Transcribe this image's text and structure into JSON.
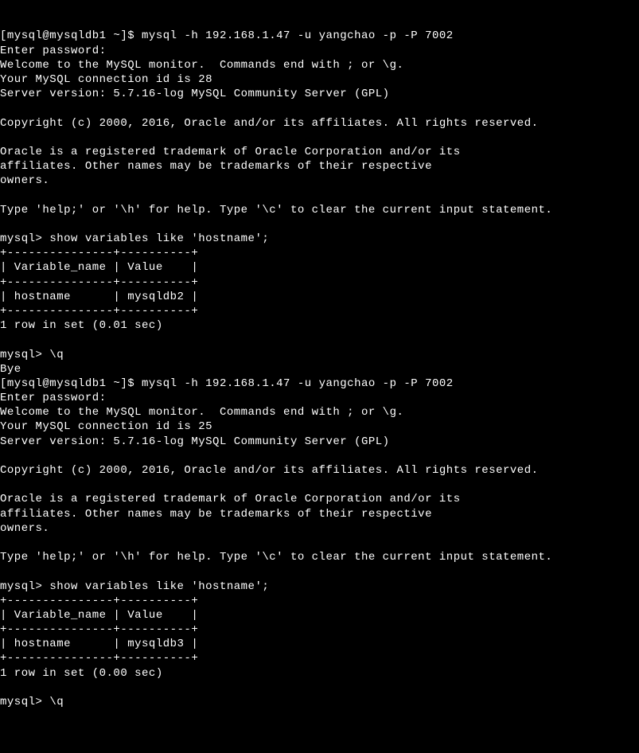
{
  "session1": {
    "shell_prompt": "[mysql@mysqldb1 ~]$ ",
    "connect_cmd": "mysql -h 192.168.1.47 -u yangchao -p -P 7002",
    "enter_password": "Enter password:",
    "welcome": "Welcome to the MySQL monitor.  Commands end with ; or \\g.",
    "conn_id": "Your MySQL connection id is 28",
    "server_version": "Server version: 5.7.16-log MySQL Community Server (GPL)",
    "copyright": "Copyright (c) 2000, 2016, Oracle and/or its affiliates. All rights reserved.",
    "trademark1": "Oracle is a registered trademark of Oracle Corporation and/or its",
    "trademark2": "affiliates. Other names may be trademarks of their respective",
    "trademark3": "owners.",
    "help_line": "Type 'help;' or '\\h' for help. Type '\\c' to clear the current input statement.",
    "mysql_prompt": "mysql> ",
    "query": "show variables like 'hostname';",
    "table_border": "+---------------+----------+",
    "table_header": "| Variable_name | Value    |",
    "table_row": "| hostname      | mysqldb2 |",
    "result_msg": "1 row in set (0.01 sec)",
    "quit_cmd": "\\q",
    "bye": "Bye"
  },
  "session2": {
    "shell_prompt": "[mysql@mysqldb1 ~]$ ",
    "connect_cmd": "mysql -h 192.168.1.47 -u yangchao -p -P 7002",
    "enter_password": "Enter password:",
    "welcome": "Welcome to the MySQL monitor.  Commands end with ; or \\g.",
    "conn_id": "Your MySQL connection id is 25",
    "server_version": "Server version: 5.7.16-log MySQL Community Server (GPL)",
    "copyright": "Copyright (c) 2000, 2016, Oracle and/or its affiliates. All rights reserved.",
    "trademark1": "Oracle is a registered trademark of Oracle Corporation and/or its",
    "trademark2": "affiliates. Other names may be trademarks of their respective",
    "trademark3": "owners.",
    "help_line": "Type 'help;' or '\\h' for help. Type '\\c' to clear the current input statement.",
    "mysql_prompt": "mysql> ",
    "query": "show variables like 'hostname';",
    "table_border": "+---------------+----------+",
    "table_header": "| Variable_name | Value    |",
    "table_row": "| hostname      | mysqldb3 |",
    "result_msg": "1 row in set (0.00 sec)",
    "quit_cmd": "\\q"
  }
}
